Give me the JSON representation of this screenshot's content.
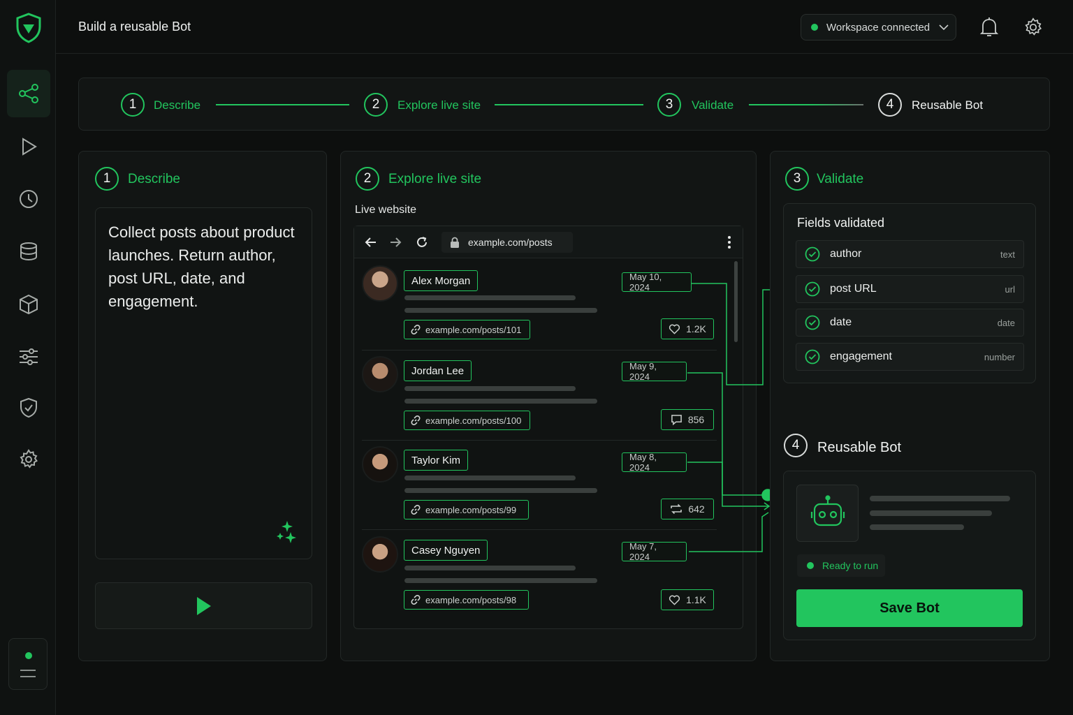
{
  "header": {
    "title": "Build a reusable Bot",
    "workspace_status": "Workspace connected"
  },
  "stepper": {
    "steps": [
      {
        "number": "1",
        "label": "Describe"
      },
      {
        "number": "2",
        "label": "Explore live site"
      },
      {
        "number": "3",
        "label": "Validate"
      },
      {
        "number": "4",
        "label": "Reusable Bot"
      }
    ]
  },
  "describe": {
    "number": "1",
    "title": "Describe",
    "prompt": "Collect posts about product launches. Return author, post URL, date, and engagement."
  },
  "explore": {
    "number": "2",
    "title": "Explore live site",
    "subtitle": "Live website",
    "url": "example.com/posts",
    "posts": [
      {
        "author": "Alex Morgan",
        "date": "May 10, 2024",
        "link": "example.com/posts/101",
        "engagement": "1.2K",
        "engagement_icon": "heart-icon"
      },
      {
        "author": "Jordan Lee",
        "date": "May 9, 2024",
        "link": "example.com/posts/100",
        "engagement": "856",
        "engagement_icon": "comment-icon"
      },
      {
        "author": "Taylor Kim",
        "date": "May 8, 2024",
        "link": "example.com/posts/99",
        "engagement": "642",
        "engagement_icon": "repost-icon"
      },
      {
        "author": "Casey Nguyen",
        "date": "May 7, 2024",
        "link": "example.com/posts/98",
        "engagement": "1.1K",
        "engagement_icon": "heart-icon"
      }
    ]
  },
  "validate": {
    "number": "3",
    "title": "Validate",
    "fields_title": "Fields validated",
    "fields": [
      {
        "name": "author",
        "type": "text"
      },
      {
        "name": "post URL",
        "type": "url"
      },
      {
        "name": "date",
        "type": "date"
      },
      {
        "name": "engagement",
        "type": "number"
      }
    ]
  },
  "bot": {
    "number": "4",
    "title": "Reusable Bot",
    "status": "Ready to run",
    "save_label": "Save Bot"
  },
  "colors": {
    "accent": "#22c55e",
    "background": "#0d0f0e",
    "panel": "#121514"
  }
}
